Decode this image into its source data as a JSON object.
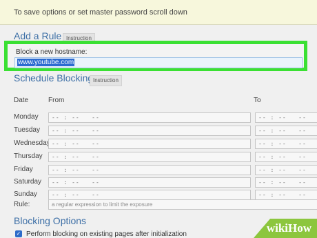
{
  "notice": "To save options or set master password scroll down",
  "add_rule": {
    "title": "Add a Rule",
    "tag": "Instruction",
    "hostname_label": "Block a new hostname:",
    "hostname_value": "www.youtube.com"
  },
  "schedule": {
    "title": "Schedule Blocking",
    "tag": "Instruction",
    "col_date": "Date",
    "col_from": "From",
    "col_to": "To",
    "time_placeholder": "-- : --   --",
    "days": [
      "Monday",
      "Tuesday",
      "Wednesday",
      "Thursday",
      "Friday",
      "Saturday",
      "Sunday"
    ],
    "rule_label": "Rule:",
    "rule_placeholder": "a regular expression to limit the exposure"
  },
  "blocking_options": {
    "title": "Blocking Options",
    "checkbox_label": "Perform blocking on existing pages after initialization",
    "checked": true
  },
  "watermark": {
    "text": "wikiHow",
    "color": "#8cc63e"
  },
  "colors": {
    "accent": "#3d6fa6",
    "highlight": "#3ae033",
    "selection": "#2c6bd1"
  }
}
